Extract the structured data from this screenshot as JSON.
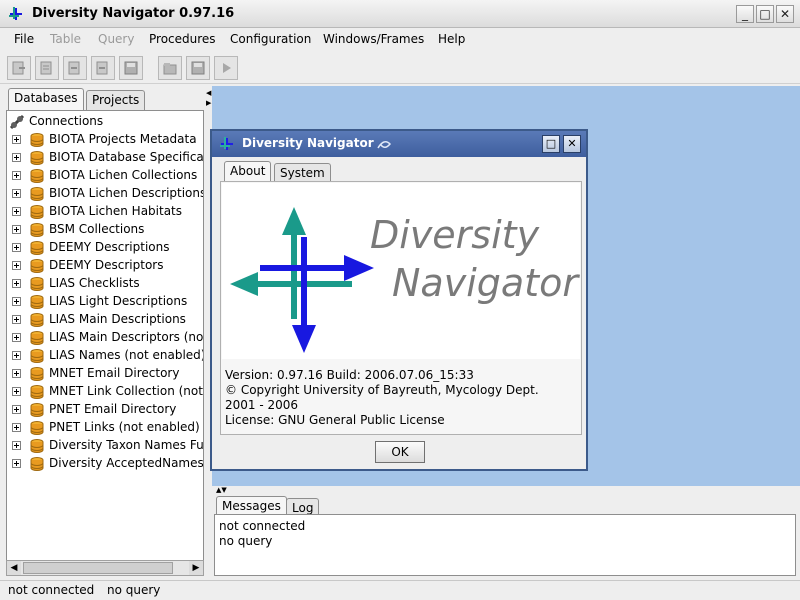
{
  "window": {
    "title": "Diversity Navigator 0.97.16",
    "controls": [
      "_",
      "□",
      "✕"
    ]
  },
  "menu": [
    {
      "label": "File",
      "enabled": true
    },
    {
      "label": "Table",
      "enabled": false
    },
    {
      "label": "Query",
      "enabled": false
    },
    {
      "label": "Procedures",
      "enabled": true
    },
    {
      "label": "Configuration",
      "enabled": true
    },
    {
      "label": "Windows/Frames",
      "enabled": true
    },
    {
      "label": "Help",
      "enabled": true
    }
  ],
  "left_panel": {
    "tabs": [
      "Databases",
      "Projects"
    ],
    "root": "Connections",
    "items": [
      "BIOTA Projects Metadata",
      "BIOTA Database Specification",
      "BIOTA Lichen Collections",
      "BIOTA Lichen Descriptions",
      "BIOTA Lichen Habitats",
      "BSM Collections",
      "DEEMY Descriptions",
      "DEEMY Descriptors",
      "LIAS Checklists",
      "LIAS Light Descriptions",
      "LIAS Main Descriptions",
      "LIAS Main Descriptors (not enabled)",
      "LIAS Names (not enabled)",
      "MNET Email Directory",
      "MNET Link Collection (not enabled)",
      "PNET Email Directory",
      "PNET Links (not enabled)",
      "Diversity Taxon Names Full",
      "Diversity AcceptedNames"
    ]
  },
  "about_dialog": {
    "title": "Diversity Navigator",
    "tabs": [
      "About",
      "System"
    ],
    "logo_line1": "Diversity",
    "logo_line2": "Navigator",
    "info": [
      "Version: 0.97.16 Build: 2006.07.06_15:33",
      "© Copyright  University of Bayreuth, Mycology Dept.",
      "2001 - 2006",
      "License: GNU General Public License"
    ],
    "ok_label": "OK"
  },
  "messages_panel": {
    "tabs": [
      "Messages",
      "Log"
    ],
    "lines": [
      "not connected",
      "no query"
    ]
  },
  "status": {
    "connection": "not connected",
    "query": "no query"
  },
  "colors": {
    "desktop": "#a4c4e8",
    "dialog_title": "#4a6aa8",
    "logo_teal": "#1a9a8a",
    "logo_blue": "#1818e0"
  }
}
